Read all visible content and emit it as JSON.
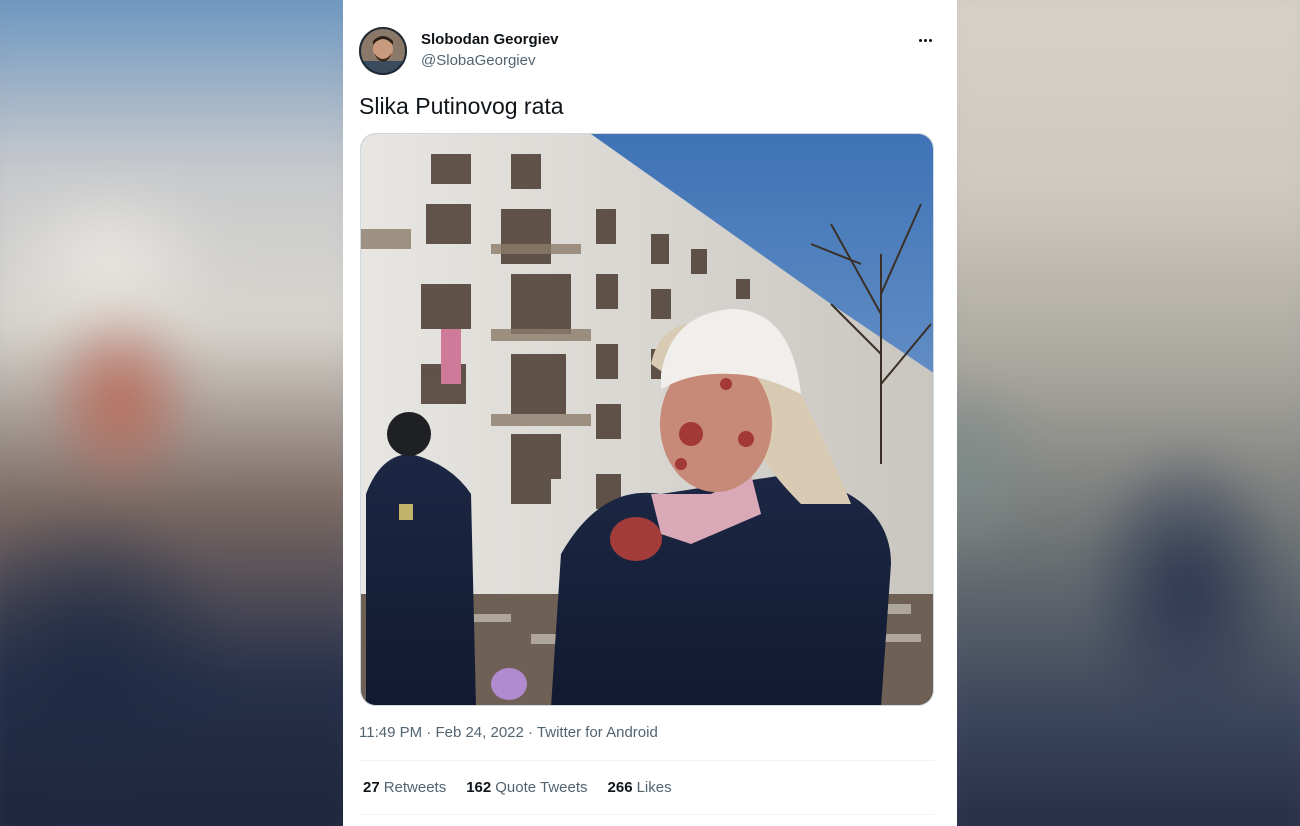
{
  "tweet": {
    "author_name": "Slobodan Georgiev",
    "author_handle": "@SlobaGeorgiev",
    "text": "Slika Putinovog rata",
    "time": "11:49 PM",
    "date": "Feb 24, 2022",
    "source": "Twitter for Android",
    "separator": "·"
  },
  "stats": [
    {
      "count": "27",
      "label": "Retweets"
    },
    {
      "count": "162",
      "label": "Quote Tweets"
    },
    {
      "count": "266",
      "label": "Likes"
    }
  ],
  "icons": {
    "more": "more-options-icon"
  },
  "colors": {
    "primary_text": "#0f1419",
    "secondary_text": "#536471",
    "divider": "#eff3f4",
    "card_bg": "#ffffff"
  }
}
